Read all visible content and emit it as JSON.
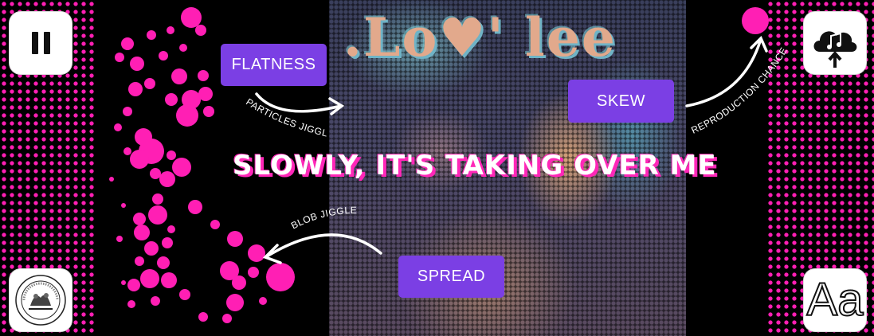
{
  "controls": {
    "pause": {
      "icon": "pause-icon"
    },
    "logo": {
      "icon": "seal-logo-icon"
    },
    "upload": {
      "icon": "cloud-music-upload-icon"
    },
    "font": {
      "icon": "font-aa-icon",
      "label": "Aa"
    }
  },
  "art": {
    "title_text": ".Lo♥' lee",
    "headline": "SLOWLY, IT'S TAKING OVER ME"
  },
  "parameters": {
    "flatness": {
      "label": "FLATNESS",
      "caption": "PARTICLES JIGGLE"
    },
    "skew": {
      "label": "SKEW",
      "caption": "REPRODUCTION CHANCE"
    },
    "spread": {
      "label": "SPREAD",
      "caption": "BLOB JIGGLE"
    }
  },
  "colors": {
    "accent_pink": "#ff1fb4",
    "button_purple": "#7b3fe4",
    "background": "#000000"
  }
}
